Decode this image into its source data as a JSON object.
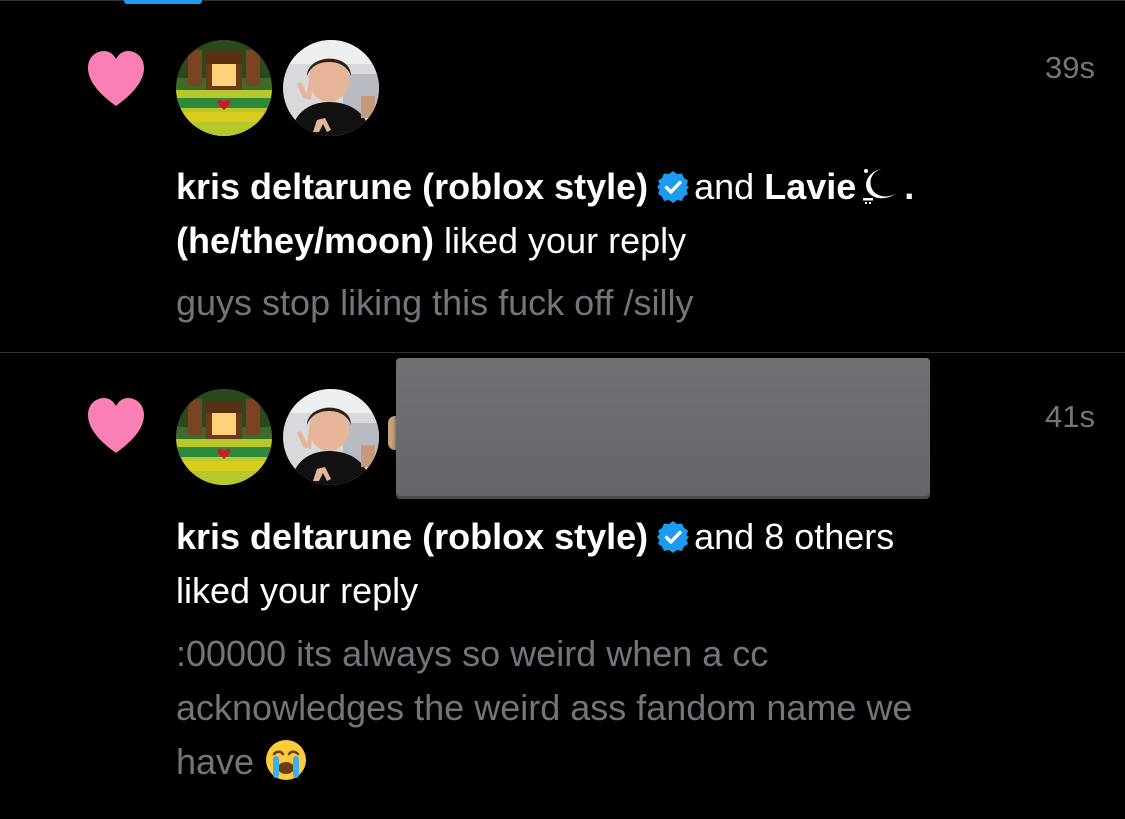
{
  "theme": {
    "background": "#000000",
    "text": "#ffffff",
    "muted": "#71767b",
    "heart": "#f97fb5",
    "verified": "#1d9bf0",
    "divider": "#2f3336",
    "redaction": "#6a6b6f"
  },
  "notifications": [
    {
      "type": "like",
      "icon": "heart-icon",
      "time": "39s",
      "avatars": [
        "kris-deltarune-avatar",
        "boy-peace-sign-avatar"
      ],
      "user1": "kris deltarune (roblox style)",
      "user1_verified": true,
      "connector": "and",
      "user2": "Lavie",
      "user2_suffix": ".",
      "user2_line2": "(he/they/moon)",
      "action": "liked your reply",
      "preview": "guys stop liking this fuck off /silly"
    },
    {
      "type": "like",
      "icon": "heart-icon",
      "time": "41s",
      "avatars": [
        "kris-deltarune-avatar",
        "boy-peace-sign-avatar"
      ],
      "user1": "kris deltarune (roblox style)",
      "user1_verified": true,
      "others": "and 8 others",
      "action": "liked your reply",
      "preview_lines": [
        ":00000 its always so weird when a cc",
        "acknowledges the weird ass fandom name we",
        "have"
      ],
      "preview_emoji": "loudly-crying-face-emoji",
      "redacted_avatars": true
    }
  ]
}
